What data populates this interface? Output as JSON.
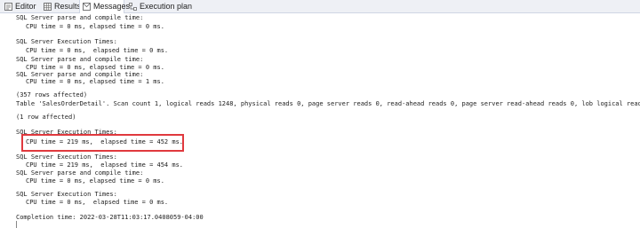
{
  "tabs": [
    {
      "label": "Editor",
      "icon": "editor-icon",
      "active": false
    },
    {
      "label": "Results",
      "icon": "grid-icon",
      "active": false
    },
    {
      "label": "Messages",
      "icon": "messages-icon",
      "active": true
    },
    {
      "label": "Execution plan",
      "icon": "execution-plan-icon",
      "active": false
    }
  ],
  "messages": [
    {
      "id": "parse-compile-1",
      "text": "SQL Server parse and compile time:"
    },
    {
      "id": "cpu-1",
      "text": "CPU time = 0 ms, elapsed time = 0 ms."
    },
    {
      "id": "exec-times-1",
      "text": "SQL Server Execution Times:"
    },
    {
      "id": "cpu-2",
      "text": "CPU time = 0 ms,  elapsed time = 0 ms."
    },
    {
      "id": "parse-compile-2",
      "text": "SQL Server parse and compile time:"
    },
    {
      "id": "cpu-3",
      "text": "CPU time = 0 ms, elapsed time = 0 ms."
    },
    {
      "id": "parse-compile-3",
      "text": "SQL Server parse and compile time:"
    },
    {
      "id": "cpu-4",
      "text": "CPU time = 0 ms, elapsed time = 1 ms."
    },
    {
      "id": "rows-357",
      "text": "(357 rows affected)"
    },
    {
      "id": "table-io",
      "text": "Table 'SalesOrderDetail'. Scan count 1, logical reads 1248, physical reads 0, page server reads 0, read-ahead reads 0, page server read-ahead reads 0, lob logical reads 0, l"
    },
    {
      "id": "rows-1",
      "text": "(1 row affected)"
    },
    {
      "id": "exec-times-2",
      "text": "SQL Server Execution Times:"
    },
    {
      "id": "cpu-5",
      "text": "CPU time = 219 ms,  elapsed time = 452 ms."
    },
    {
      "id": "exec-times-3",
      "text": "SQL Server Execution Times:"
    },
    {
      "id": "cpu-6",
      "text": "CPU time = 219 ms,  elapsed time = 454 ms."
    },
    {
      "id": "parse-compile-4",
      "text": "SQL Server parse and compile time:"
    },
    {
      "id": "cpu-7",
      "text": "CPU time = 0 ms, elapsed time = 0 ms."
    },
    {
      "id": "exec-times-4",
      "text": "SQL Server Execution Times:"
    },
    {
      "id": "cpu-8",
      "text": "CPU time = 0 ms,  elapsed time = 0 ms."
    },
    {
      "id": "completion",
      "text": "Completion time: 2022-03-28T11:03:17.0408059-04:00"
    }
  ],
  "colors": {
    "highlight_border": "#e0393e",
    "tab_strip": "#eef0f5"
  }
}
